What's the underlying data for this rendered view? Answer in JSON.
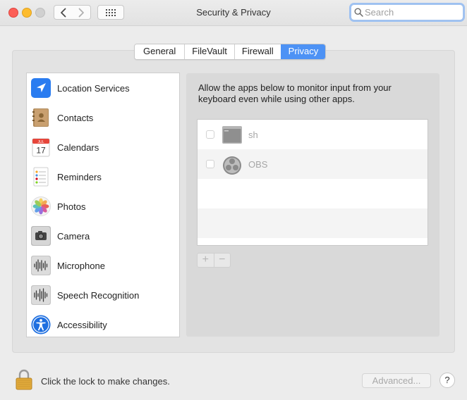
{
  "window": {
    "title": "Security & Privacy"
  },
  "search": {
    "placeholder": "Search",
    "value": ""
  },
  "tabs": [
    {
      "label": "General",
      "active": false
    },
    {
      "label": "FileVault",
      "active": false
    },
    {
      "label": "Firewall",
      "active": false
    },
    {
      "label": "Privacy",
      "active": true
    }
  ],
  "sidebar": {
    "items": [
      {
        "label": "Location Services",
        "icon": "location-arrow-icon",
        "selected": false
      },
      {
        "label": "Contacts",
        "icon": "contacts-book-icon",
        "selected": false
      },
      {
        "label": "Calendars",
        "icon": "calendar-icon",
        "selected": false
      },
      {
        "label": "Reminders",
        "icon": "reminders-list-icon",
        "selected": false
      },
      {
        "label": "Photos",
        "icon": "photos-flower-icon",
        "selected": false
      },
      {
        "label": "Camera",
        "icon": "camera-icon",
        "selected": false
      },
      {
        "label": "Microphone",
        "icon": "microphone-waveform-icon",
        "selected": false
      },
      {
        "label": "Speech Recognition",
        "icon": "speech-waveform-icon",
        "selected": false
      },
      {
        "label": "Accessibility",
        "icon": "accessibility-icon",
        "selected": false
      }
    ],
    "calendar_day": "17",
    "calendar_month": "JUL"
  },
  "main": {
    "description": "Allow the apps below to monitor input from your keyboard even while using other apps.",
    "apps": [
      {
        "name": "sh",
        "checked": false,
        "icon": "terminal-icon"
      },
      {
        "name": "OBS",
        "checked": false,
        "icon": "obs-icon"
      }
    ],
    "add_label": "+",
    "remove_label": "−"
  },
  "footer": {
    "lock_text": "Click the lock to make changes.",
    "advanced_label": "Advanced...",
    "help_label": "?"
  },
  "colors": {
    "accent": "#4d92f5",
    "window_bg": "#ececec",
    "panel_bg": "#e3e3e3"
  }
}
